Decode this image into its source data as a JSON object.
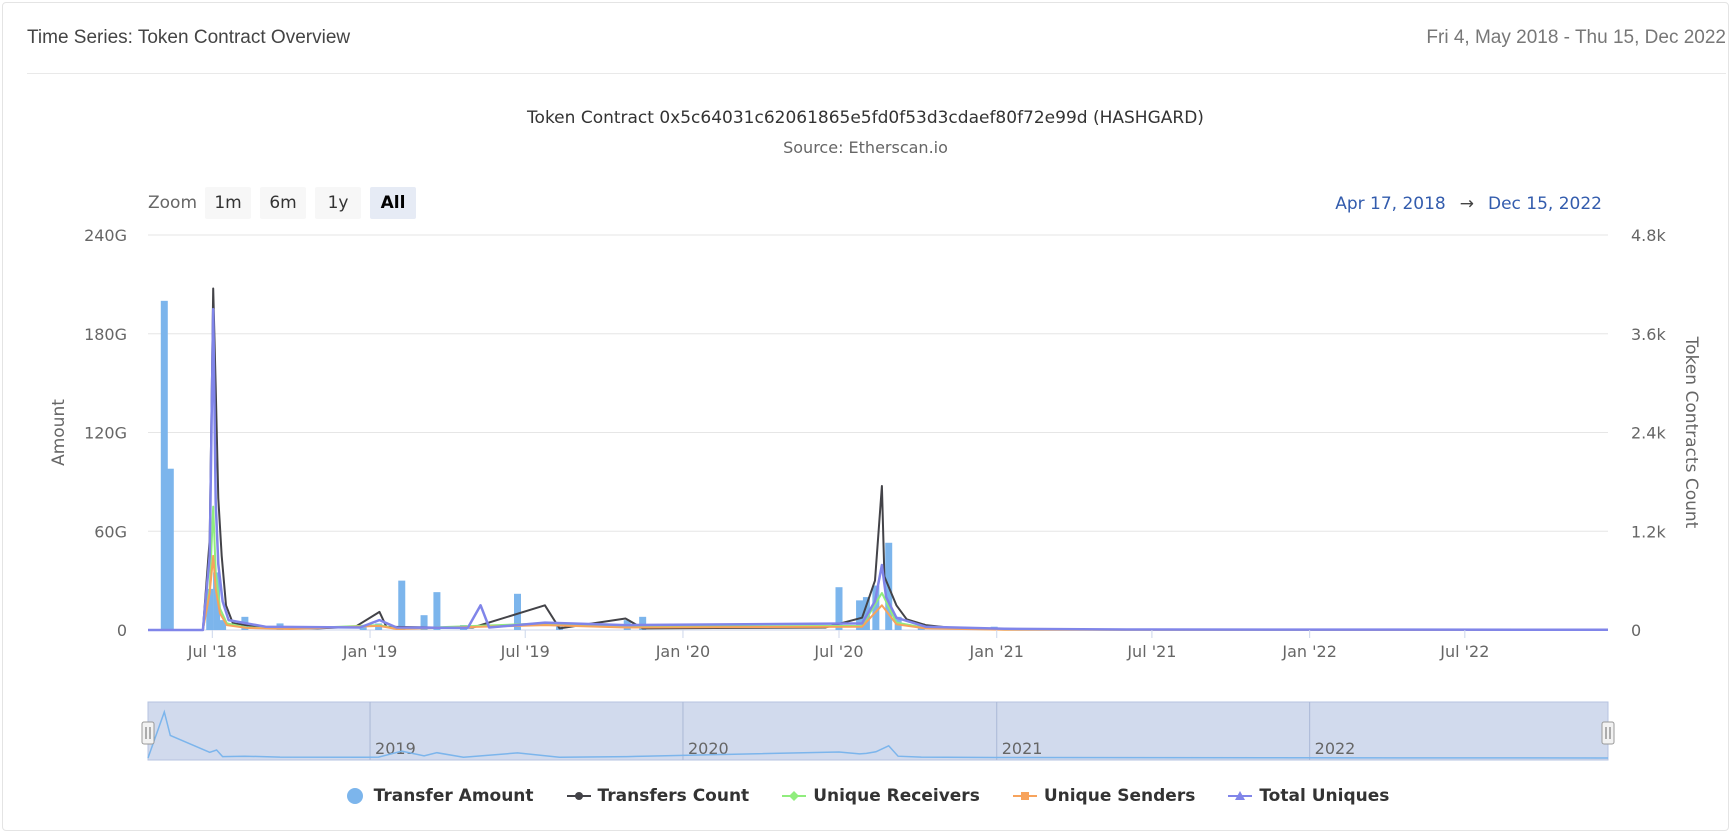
{
  "card": {
    "title": "Time Series: Token Contract Overview",
    "date_range": "Fri 4, May 2018 - Thu 15, Dec 2022"
  },
  "zoom": {
    "label": "Zoom",
    "buttons": [
      "1m",
      "6m",
      "1y",
      "All"
    ],
    "active": "All"
  },
  "range_selector": {
    "from": "Apr 17, 2018",
    "arrow": "→",
    "to": "Dec 15, 2022"
  },
  "navigator": {
    "year_labels": [
      "2019",
      "2020",
      "2021",
      "2022"
    ]
  },
  "colors": {
    "transfer_amount": "#7cb5ec",
    "transfers_count": "#434348",
    "unique_receivers": "#90ed7d",
    "unique_senders": "#f7a35c",
    "total_uniques": "#8085e9",
    "range_text": "#335cad",
    "navigator_fill": "#ccd6eb"
  },
  "chart_data": {
    "type": "bar",
    "title": "Token Contract 0x5c64031c62061865e5fd0f53d3cdaef80f72e99d (HASHGARD)",
    "subtitle": "Source: Etherscan.io",
    "x_range": [
      "2018-04-17",
      "2022-12-15"
    ],
    "x_ticks": [
      {
        "date": "2018-07-01",
        "label": "Jul '18"
      },
      {
        "date": "2019-01-01",
        "label": "Jan '19"
      },
      {
        "date": "2019-07-01",
        "label": "Jul '19"
      },
      {
        "date": "2020-01-01",
        "label": "Jan '20"
      },
      {
        "date": "2020-07-01",
        "label": "Jul '20"
      },
      {
        "date": "2021-01-01",
        "label": "Jan '21"
      },
      {
        "date": "2021-07-01",
        "label": "Jul '21"
      },
      {
        "date": "2022-01-01",
        "label": "Jan '22"
      },
      {
        "date": "2022-07-01",
        "label": "Jul '22"
      }
    ],
    "y_left": {
      "label": "Amount",
      "min": 0,
      "max": 240,
      "ticks": [
        {
          "v": 0,
          "label": "0"
        },
        {
          "v": 60,
          "label": "60G"
        },
        {
          "v": 120,
          "label": "120G"
        },
        {
          "v": 180,
          "label": "180G"
        },
        {
          "v": 240,
          "label": "240G"
        }
      ]
    },
    "y_right": {
      "label": "Token Contracts Count",
      "min": 0,
      "max": 4800,
      "ticks": [
        {
          "v": 0,
          "label": "0"
        },
        {
          "v": 1200,
          "label": "1.2k"
        },
        {
          "v": 2400,
          "label": "2.4k"
        },
        {
          "v": 3600,
          "label": "3.6k"
        },
        {
          "v": 4800,
          "label": "4.8k"
        }
      ]
    },
    "grid": true,
    "legend_position": "bottom-center",
    "series": [
      {
        "name": "Transfer Amount",
        "kind": "column",
        "axis": "left",
        "points": [
          [
            "2018-05-06",
            200
          ],
          [
            "2018-05-13",
            98
          ],
          [
            "2018-06-28",
            25
          ],
          [
            "2018-07-06",
            35
          ],
          [
            "2018-07-13",
            6
          ],
          [
            "2018-08-08",
            8
          ],
          [
            "2018-09-18",
            4
          ],
          [
            "2018-12-24",
            3
          ],
          [
            "2019-01-11",
            4
          ],
          [
            "2019-02-07",
            30
          ],
          [
            "2019-03-05",
            9
          ],
          [
            "2019-03-20",
            23
          ],
          [
            "2019-04-20",
            3
          ],
          [
            "2019-06-22",
            22
          ],
          [
            "2019-08-10",
            3
          ],
          [
            "2019-10-28",
            6
          ],
          [
            "2019-11-15",
            8
          ],
          [
            "2020-07-01",
            26
          ],
          [
            "2020-07-25",
            18
          ],
          [
            "2020-08-02",
            20
          ],
          [
            "2020-08-13",
            27
          ],
          [
            "2020-08-28",
            53
          ],
          [
            "2020-09-08",
            8
          ],
          [
            "2020-10-05",
            4
          ],
          [
            "2020-12-29",
            2
          ]
        ]
      },
      {
        "name": "Transfers Count",
        "kind": "line",
        "axis": "right",
        "points": [
          [
            "2018-04-17",
            0
          ],
          [
            "2018-06-20",
            0
          ],
          [
            "2018-06-28",
            1100
          ],
          [
            "2018-07-02",
            4150
          ],
          [
            "2018-07-05",
            2950
          ],
          [
            "2018-07-08",
            1600
          ],
          [
            "2018-07-12",
            900
          ],
          [
            "2018-07-17",
            300
          ],
          [
            "2018-07-25",
            80
          ],
          [
            "2018-08-10",
            60
          ],
          [
            "2018-09-01",
            30
          ],
          [
            "2018-11-01",
            20
          ],
          [
            "2018-12-15",
            40
          ],
          [
            "2019-01-12",
            220
          ],
          [
            "2019-01-20",
            40
          ],
          [
            "2019-03-15",
            30
          ],
          [
            "2019-05-01",
            30
          ],
          [
            "2019-07-24",
            300
          ],
          [
            "2019-08-10",
            20
          ],
          [
            "2019-10-26",
            140
          ],
          [
            "2019-11-15",
            20
          ],
          [
            "2020-06-15",
            30
          ],
          [
            "2020-07-28",
            150
          ],
          [
            "2020-08-12",
            600
          ],
          [
            "2020-08-20",
            1750
          ],
          [
            "2020-08-23",
            650
          ],
          [
            "2020-09-06",
            300
          ],
          [
            "2020-09-18",
            130
          ],
          [
            "2020-10-10",
            60
          ],
          [
            "2020-11-15",
            20
          ],
          [
            "2021-01-10",
            10
          ],
          [
            "2021-06-01",
            5
          ],
          [
            "2022-12-15",
            2
          ]
        ]
      },
      {
        "name": "Unique Receivers",
        "kind": "line",
        "axis": "right",
        "points": [
          [
            "2018-04-17",
            0
          ],
          [
            "2018-06-20",
            0
          ],
          [
            "2018-06-28",
            500
          ],
          [
            "2018-07-02",
            1500
          ],
          [
            "2018-07-05",
            700
          ],
          [
            "2018-07-10",
            260
          ],
          [
            "2018-07-18",
            80
          ],
          [
            "2018-08-10",
            30
          ],
          [
            "2018-10-01",
            15
          ],
          [
            "2019-01-12",
            60
          ],
          [
            "2019-02-01",
            15
          ],
          [
            "2019-07-24",
            80
          ],
          [
            "2019-10-26",
            40
          ],
          [
            "2020-07-28",
            50
          ],
          [
            "2020-08-20",
            450
          ],
          [
            "2020-09-06",
            90
          ],
          [
            "2020-10-10",
            25
          ],
          [
            "2021-01-10",
            5
          ],
          [
            "2022-12-15",
            1
          ]
        ]
      },
      {
        "name": "Unique Senders",
        "kind": "line",
        "axis": "right",
        "points": [
          [
            "2018-04-17",
            0
          ],
          [
            "2018-06-20",
            0
          ],
          [
            "2018-06-28",
            450
          ],
          [
            "2018-07-02",
            900
          ],
          [
            "2018-07-05",
            500
          ],
          [
            "2018-07-10",
            200
          ],
          [
            "2018-07-18",
            60
          ],
          [
            "2018-08-10",
            25
          ],
          [
            "2018-10-01",
            12
          ],
          [
            "2019-01-12",
            50
          ],
          [
            "2019-02-01",
            12
          ],
          [
            "2019-07-24",
            60
          ],
          [
            "2019-10-26",
            30
          ],
          [
            "2020-07-28",
            40
          ],
          [
            "2020-08-20",
            300
          ],
          [
            "2020-09-06",
            70
          ],
          [
            "2020-10-10",
            20
          ],
          [
            "2021-01-10",
            4
          ],
          [
            "2022-12-15",
            1
          ]
        ]
      },
      {
        "name": "Total Uniques",
        "kind": "line",
        "axis": "right",
        "points": [
          [
            "2018-04-17",
            0
          ],
          [
            "2018-06-20",
            0
          ],
          [
            "2018-06-28",
            900
          ],
          [
            "2018-07-02",
            3900
          ],
          [
            "2018-07-05",
            1550
          ],
          [
            "2018-07-08",
            800
          ],
          [
            "2018-07-13",
            350
          ],
          [
            "2018-07-20",
            120
          ],
          [
            "2018-08-10",
            80
          ],
          [
            "2018-09-01",
            40
          ],
          [
            "2018-12-20",
            30
          ],
          [
            "2019-01-12",
            120
          ],
          [
            "2019-02-01",
            30
          ],
          [
            "2019-04-25",
            25
          ],
          [
            "2019-05-10",
            300
          ],
          [
            "2019-05-20",
            30
          ],
          [
            "2019-07-24",
            90
          ],
          [
            "2019-10-26",
            60
          ],
          [
            "2020-07-28",
            80
          ],
          [
            "2020-08-12",
            350
          ],
          [
            "2020-08-20",
            790
          ],
          [
            "2020-08-25",
            400
          ],
          [
            "2020-09-06",
            150
          ],
          [
            "2020-10-10",
            40
          ],
          [
            "2021-01-10",
            15
          ],
          [
            "2021-06-01",
            6
          ],
          [
            "2022-12-15",
            2
          ]
        ]
      }
    ]
  }
}
